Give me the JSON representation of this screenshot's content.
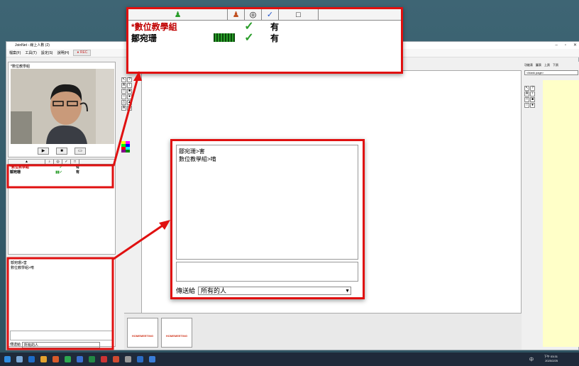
{
  "window": {
    "title": "JoinNet - 線上人數 (2)"
  },
  "menu": {
    "items": [
      "檔案(F)",
      "工具(T)",
      "設定(S)",
      "說明(H)"
    ],
    "rec_label": "REC"
  },
  "video": {
    "caption": "*數位教學組"
  },
  "participants": {
    "columns": [
      "name-icon",
      "speaker-icon",
      "camera-icon",
      "check-icon",
      "doc-icon"
    ],
    "rows": [
      {
        "name": "*數位教學組",
        "status": "有",
        "color": "#c00000"
      },
      {
        "name": "鄒宛珊",
        "status": "有",
        "color": "#000000"
      }
    ]
  },
  "chat": {
    "messages": [
      "鄒宛珊>害",
      "數位教學組>唷"
    ],
    "send_to_label": "傳送給",
    "send_to_value": "所有的人"
  },
  "right_panel": {
    "page_select": "<blank page>",
    "zoom_label": "正文",
    "tabs": [
      "功能表",
      "圖表",
      "上頁",
      "下頁"
    ]
  },
  "thumbnails": {
    "label": "HOMEMEETING"
  },
  "status": {
    "timer": "時間 0:04"
  },
  "clock": {
    "time": "下午 03:31",
    "date": "2020/2/25"
  },
  "ime": {
    "label": "中"
  },
  "colors": {
    "highlight": "#e01010",
    "accent_green": "#2a9d2a",
    "canvas_yellow": "#ffffc8"
  }
}
